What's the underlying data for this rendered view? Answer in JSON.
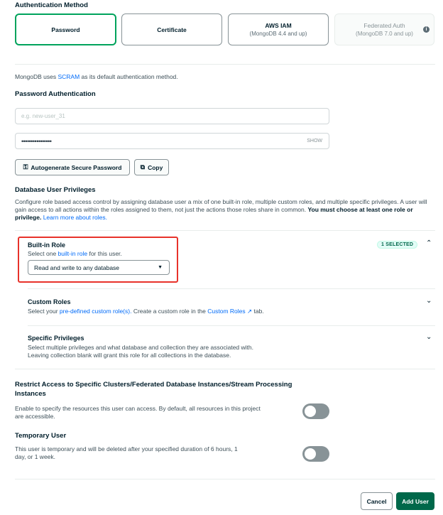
{
  "auth": {
    "title": "Authentication Method",
    "options": [
      {
        "label": "Password",
        "sub": ""
      },
      {
        "label": "Certificate",
        "sub": ""
      },
      {
        "label": "AWS IAM",
        "sub": "(MongoDB 4.4 and up)"
      },
      {
        "label": "Federated Auth",
        "sub": "(MongoDB 7.0 and up)"
      }
    ],
    "info_icon": "info-icon",
    "note_prefix": "MongoDB uses ",
    "note_link": "SCRAM",
    "note_suffix": " as its default authentication method."
  },
  "password_auth": {
    "title": "Password Authentication",
    "username_placeholder": "e.g. new-user_31",
    "password_value": "••••••••••••••••",
    "show_label": "SHOW",
    "autogen_label": "Autogenerate Secure Password",
    "copy_label": "Copy",
    "autogen_icon": "key-icon",
    "copy_icon": "copy-icon"
  },
  "privileges": {
    "title": "Database User Privileges",
    "desc_1": "Configure role based access control by assigning database user a mix of one built-in role, multiple custom roles, and multiple specific privileges. A user will gain access to all actions within the roles assigned to them, not just the actions those roles share in common. ",
    "desc_bold": "You must choose at least one role or privilege.",
    "desc_link": "Learn more about roles.",
    "builtin": {
      "title": "Built-in Role",
      "sub_prefix": "Select one ",
      "sub_link": "built-in role",
      "sub_suffix": " for this user.",
      "selected_value": "Read and write to any database",
      "badge": "1 SELECTED"
    },
    "custom": {
      "title": "Custom Roles",
      "sub_prefix": "Select your ",
      "sub_link": "pre-defined custom role(s).",
      "sub_middle": " Create a custom role in the ",
      "sub_link2": "Custom Roles",
      "sub_suffix": " tab."
    },
    "specific": {
      "title": "Specific Privileges",
      "line1": "Select multiple privileges and what database and collection they are associated with.",
      "line2": "Leaving collection blank will grant this role for all collections in the database."
    }
  },
  "restrict": {
    "title_line1": "Restrict Access to Specific Clusters/Federated Database Instances/Stream Processing",
    "title_line2": "Instances",
    "desc_line1": "Enable to specify the resources this user can access. By default, all resources in this project",
    "desc_line2": "are accessible.",
    "enabled": false
  },
  "temporary": {
    "title": "Temporary User",
    "desc_line1": "This user is temporary and will be deleted after your specified duration of 6 hours, 1",
    "desc_line2": "day, or 1 week.",
    "enabled": false
  },
  "footer": {
    "cancel_label": "Cancel",
    "add_label": "Add User"
  },
  "colors": {
    "accent_green": "#00a35c",
    "add_button": "#00684a",
    "link_blue": "#016bf8",
    "highlight_red": "#e8322a"
  }
}
